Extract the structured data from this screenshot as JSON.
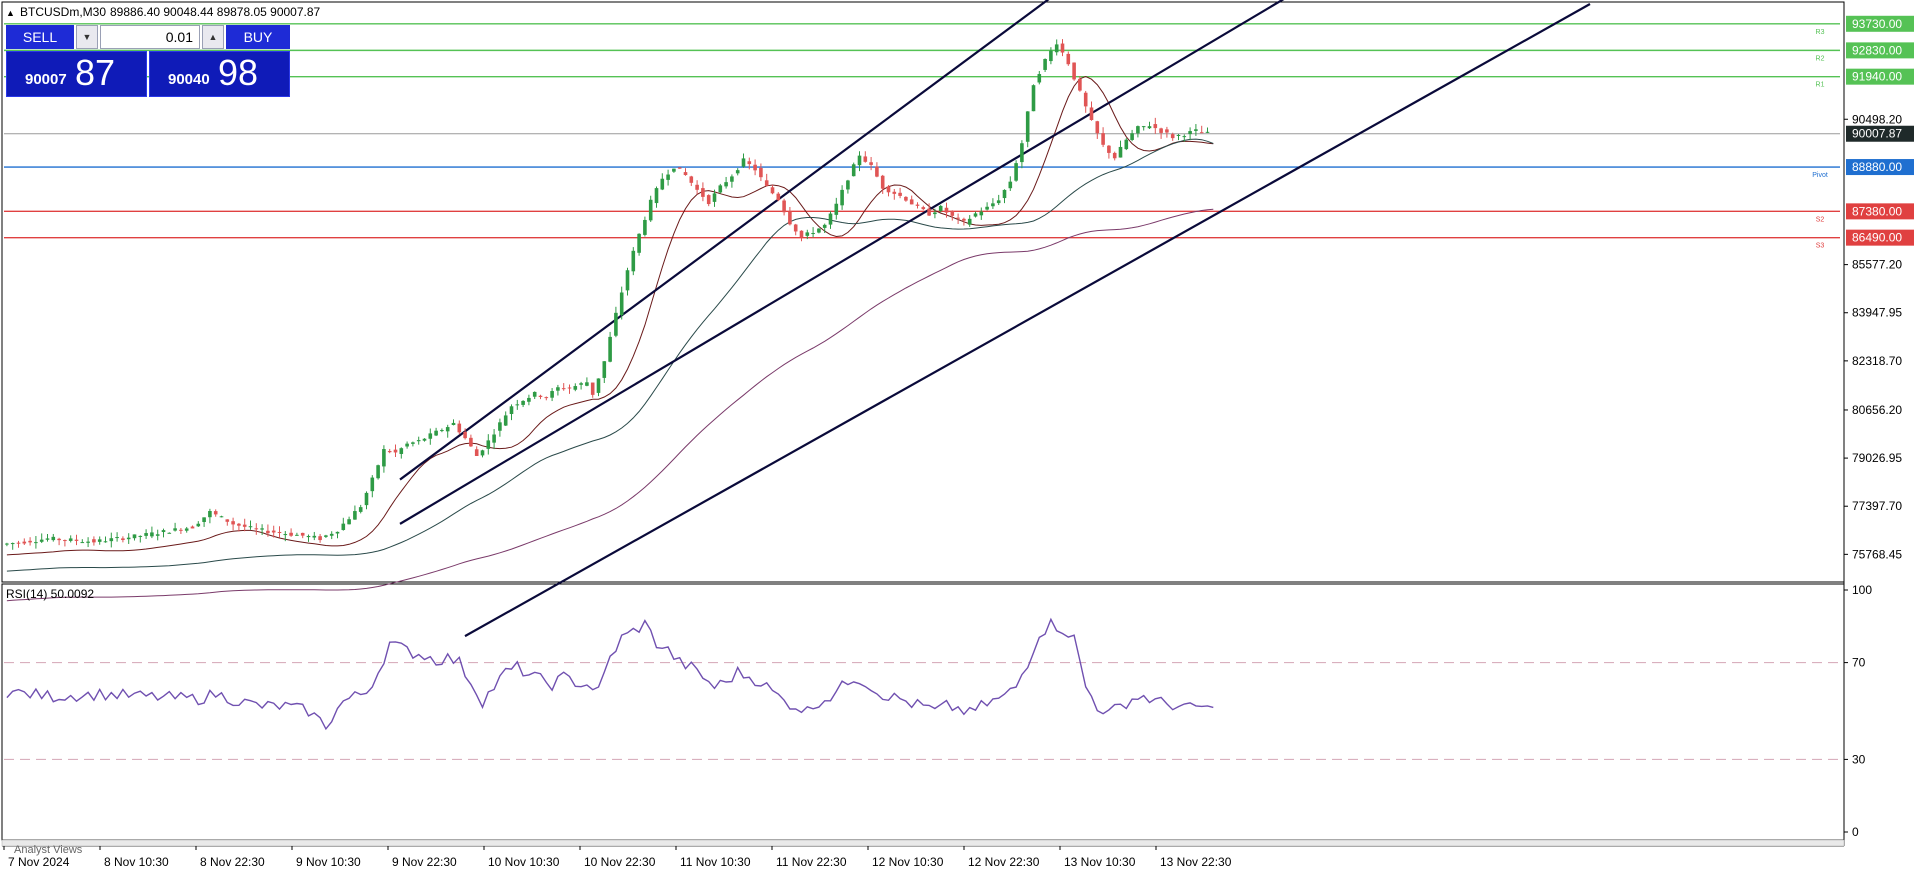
{
  "header": {
    "symbol": "BTCUSDm,M30",
    "ohlc": "89886.40 90048.44 89878.05 90007.87"
  },
  "trade_panel": {
    "sell_label": "SELL",
    "buy_label": "BUY",
    "lot_value": "0.01",
    "sell_price_small": "90007",
    "sell_price_big": "87",
    "buy_price_small": "90040",
    "buy_price_big": "98"
  },
  "rsi_panel": {
    "label": "RSI(14) 50.0092",
    "levels": [
      70,
      30
    ],
    "axis_labels": [
      "100",
      "70",
      "30",
      "0"
    ]
  },
  "bottom_tab": "Analyst Views",
  "colors": {
    "bull": "#2e9b45",
    "bear": "#e05555",
    "resistance": "#55c255",
    "support": "#e04040",
    "pivot": "#1f6fd0",
    "channel": "#0a0a3a",
    "rsi": "#7050b0",
    "ma_fast": "#6a1a1a",
    "ma_mid": "#2a4a4a",
    "ma_slow": "#7a3a6a"
  },
  "chart_data": {
    "type": "candlestick",
    "symbol": "BTCUSDm",
    "timeframe": "M30",
    "ylim": [
      74900,
      94400
    ],
    "price_ticks": [
      "93730.00",
      "92830.00",
      "91940.00",
      "90498.20",
      "90007.87",
      "88880.00",
      "87380.00",
      "86490.00",
      "85577.20",
      "83947.95",
      "82318.70",
      "80656.20",
      "79026.95",
      "77397.70",
      "75768.45"
    ],
    "x_tick_labels": [
      "7 Nov 2024",
      "8 Nov 10:30",
      "8 Nov 22:30",
      "9 Nov 10:30",
      "9 Nov 22:30",
      "10 Nov 10:30",
      "10 Nov 22:30",
      "11 Nov 10:30",
      "11 Nov 22:30",
      "12 Nov 10:30",
      "12 Nov 22:30",
      "13 Nov 10:30",
      "13 Nov 22:30"
    ],
    "current_price": 90007.87,
    "levels": [
      {
        "name": "R3",
        "value": 93730.0,
        "kind": "resistance"
      },
      {
        "name": "R2",
        "value": 92830.0,
        "kind": "resistance"
      },
      {
        "name": "R1",
        "value": 91940.0,
        "kind": "resistance"
      },
      {
        "name": "Pivot",
        "value": 88880.0,
        "kind": "pivot"
      },
      {
        "name": "S2",
        "value": 87380.0,
        "kind": "support"
      },
      {
        "name": "S3",
        "value": 86490.0,
        "kind": "support"
      }
    ],
    "price_path": [
      [
        0,
        76100
      ],
      [
        8,
        76300
      ],
      [
        16,
        76200
      ],
      [
        24,
        76400
      ],
      [
        33,
        76700
      ],
      [
        36,
        77200
      ],
      [
        40,
        76800
      ],
      [
        44,
        76600
      ],
      [
        48,
        76500
      ],
      [
        52,
        76400
      ],
      [
        55,
        76300
      ],
      [
        58,
        76600
      ],
      [
        62,
        77400
      ],
      [
        64,
        78300
      ],
      [
        66,
        79300
      ],
      [
        68,
        79200
      ],
      [
        70,
        79500
      ],
      [
        72,
        79600
      ],
      [
        74,
        79800
      ],
      [
        76,
        80000
      ],
      [
        78,
        80200
      ],
      [
        80,
        79700
      ],
      [
        82,
        79100
      ],
      [
        84,
        79600
      ],
      [
        86,
        80200
      ],
      [
        88,
        80800
      ],
      [
        90,
        81000
      ],
      [
        92,
        81200
      ],
      [
        94,
        81100
      ],
      [
        96,
        81400
      ],
      [
        98,
        81400
      ],
      [
        101,
        81600
      ],
      [
        102,
        81200
      ],
      [
        104,
        82300
      ],
      [
        106,
        83900
      ],
      [
        108,
        85400
      ],
      [
        110,
        86600
      ],
      [
        112,
        87700
      ],
      [
        114,
        88500
      ],
      [
        116,
        88900
      ],
      [
        118,
        88600
      ],
      [
        120,
        88100
      ],
      [
        122,
        87700
      ],
      [
        124,
        88200
      ],
      [
        126,
        88600
      ],
      [
        128,
        89100
      ],
      [
        130,
        88800
      ],
      [
        132,
        88200
      ],
      [
        134,
        87800
      ],
      [
        136,
        87000
      ],
      [
        138,
        86500
      ],
      [
        140,
        86700
      ],
      [
        142,
        86900
      ],
      [
        144,
        87600
      ],
      [
        146,
        88500
      ],
      [
        148,
        89300
      ],
      [
        150,
        88900
      ],
      [
        152,
        88200
      ],
      [
        154,
        88000
      ],
      [
        156,
        87800
      ],
      [
        158,
        87500
      ],
      [
        160,
        87300
      ],
      [
        162,
        87500
      ],
      [
        164,
        87200
      ],
      [
        166,
        87000
      ],
      [
        168,
        87300
      ],
      [
        170,
        87500
      ],
      [
        172,
        87800
      ],
      [
        174,
        88400
      ],
      [
        176,
        89700
      ],
      [
        178,
        91700
      ],
      [
        180,
        92500
      ],
      [
        182,
        93100
      ],
      [
        184,
        92400
      ],
      [
        186,
        91400
      ],
      [
        188,
        90400
      ],
      [
        190,
        89600
      ],
      [
        192,
        89200
      ],
      [
        194,
        89800
      ],
      [
        196,
        90200
      ],
      [
        198,
        90300
      ],
      [
        200,
        90100
      ],
      [
        202,
        89900
      ],
      [
        204,
        90000
      ],
      [
        206,
        90100
      ],
      [
        208,
        90007.87
      ]
    ],
    "rsi_path": [
      [
        0,
        58
      ],
      [
        8,
        56
      ],
      [
        16,
        57
      ],
      [
        24,
        56
      ],
      [
        33,
        55
      ],
      [
        36,
        57
      ],
      [
        40,
        54
      ],
      [
        44,
        52
      ],
      [
        48,
        52
      ],
      [
        52,
        50
      ],
      [
        55,
        44
      ],
      [
        58,
        54
      ],
      [
        62,
        58
      ],
      [
        64,
        66
      ],
      [
        66,
        78
      ],
      [
        68,
        76
      ],
      [
        70,
        74
      ],
      [
        72,
        73
      ],
      [
        74,
        71
      ],
      [
        76,
        72
      ],
      [
        78,
        70
      ],
      [
        80,
        62
      ],
      [
        82,
        54
      ],
      [
        84,
        60
      ],
      [
        86,
        66
      ],
      [
        88,
        68
      ],
      [
        90,
        65
      ],
      [
        92,
        63
      ],
      [
        94,
        61
      ],
      [
        96,
        64
      ],
      [
        98,
        62
      ],
      [
        101,
        60
      ],
      [
        102,
        58
      ],
      [
        104,
        72
      ],
      [
        106,
        80
      ],
      [
        108,
        83
      ],
      [
        110,
        86
      ],
      [
        112,
        78
      ],
      [
        114,
        75
      ],
      [
        116,
        70
      ],
      [
        118,
        68
      ],
      [
        120,
        64
      ],
      [
        122,
        60
      ],
      [
        124,
        62
      ],
      [
        126,
        66
      ],
      [
        128,
        64
      ],
      [
        130,
        62
      ],
      [
        132,
        58
      ],
      [
        134,
        54
      ],
      [
        136,
        52
      ],
      [
        138,
        50
      ],
      [
        140,
        54
      ],
      [
        142,
        56
      ],
      [
        144,
        60
      ],
      [
        146,
        64
      ],
      [
        148,
        62
      ],
      [
        150,
        58
      ],
      [
        152,
        56
      ],
      [
        154,
        55
      ],
      [
        156,
        53
      ],
      [
        158,
        52
      ],
      [
        160,
        50
      ],
      [
        162,
        52
      ],
      [
        164,
        51
      ],
      [
        166,
        49
      ],
      [
        168,
        52
      ],
      [
        170,
        54
      ],
      [
        172,
        56
      ],
      [
        174,
        60
      ],
      [
        176,
        70
      ],
      [
        178,
        82
      ],
      [
        180,
        86
      ],
      [
        182,
        84
      ],
      [
        184,
        80
      ],
      [
        186,
        60
      ],
      [
        188,
        52
      ],
      [
        190,
        49
      ],
      [
        192,
        52
      ],
      [
        194,
        55
      ],
      [
        196,
        56
      ],
      [
        198,
        54
      ],
      [
        200,
        53
      ],
      [
        202,
        52
      ],
      [
        204,
        51
      ],
      [
        206,
        52
      ],
      [
        208,
        50.01
      ]
    ],
    "channel_lines": [
      [
        [
          0,
          78300
        ],
        [
          200,
          95800
        ]
      ],
      [
        [
          0,
          76800
        ],
        [
          206,
          95900
        ]
      ],
      [
        [
          0,
          73000
        ],
        [
          212,
          94400
        ]
      ]
    ]
  }
}
